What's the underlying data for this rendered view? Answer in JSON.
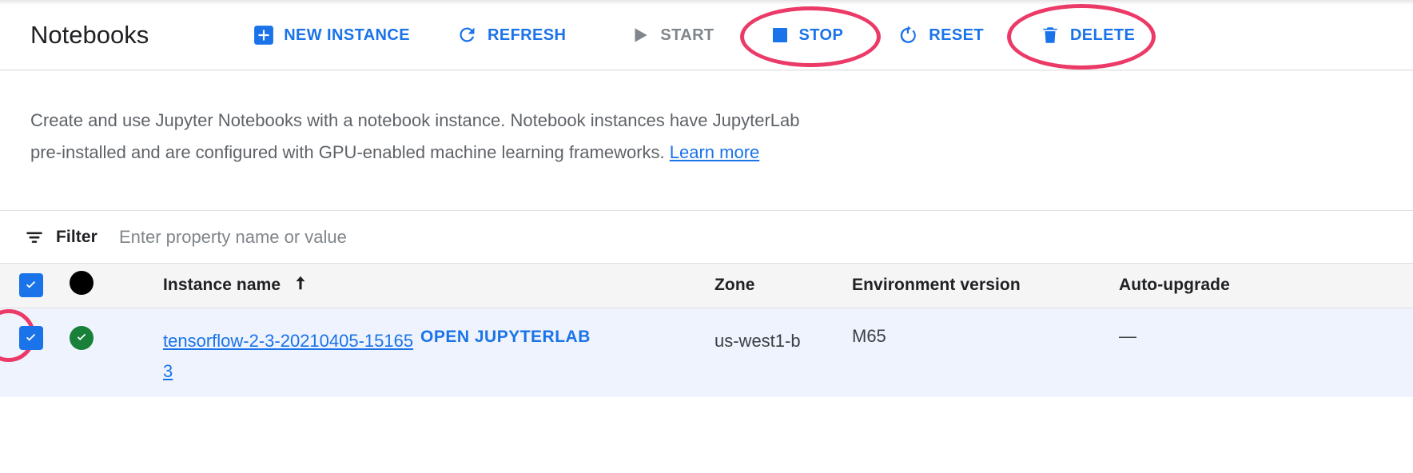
{
  "header": {
    "title": "Notebooks",
    "buttons": [
      {
        "label": "NEW INSTANCE",
        "icon": "plus-box-icon",
        "state": "enabled"
      },
      {
        "label": "REFRESH",
        "icon": "refresh-icon",
        "state": "enabled"
      },
      {
        "label": "START",
        "icon": "play-icon",
        "state": "disabled"
      },
      {
        "label": "STOP",
        "icon": "stop-square-icon",
        "state": "enabled",
        "annotated": true
      },
      {
        "label": "RESET",
        "icon": "power-reset-icon",
        "state": "enabled"
      },
      {
        "label": "DELETE",
        "icon": "trash-icon",
        "state": "enabled",
        "annotated": true
      }
    ]
  },
  "description": {
    "text_before": "Create and use Jupyter Notebooks with a notebook instance. Notebook instances have JupyterLab pre-installed and are configured with GPU-enabled machine learning frameworks. ",
    "link_label": "Learn more"
  },
  "filter": {
    "icon": "filter-icon",
    "label": "Filter",
    "placeholder": "Enter property name or value",
    "value": ""
  },
  "table": {
    "columns": [
      {
        "key": "checkbox",
        "label": ""
      },
      {
        "key": "status",
        "label": ""
      },
      {
        "key": "name",
        "label": "Instance name",
        "sort": "ascending",
        "sort_icon": "arrow-up-icon"
      },
      {
        "key": "open",
        "label": ""
      },
      {
        "key": "zone",
        "label": "Zone"
      },
      {
        "key": "env",
        "label": "Environment version"
      },
      {
        "key": "auto",
        "label": "Auto-upgrade"
      }
    ],
    "header_select_all_checked": true,
    "rows": [
      {
        "selected": true,
        "checkbox_annotated": true,
        "status": "healthy",
        "name": "tensorflow-2-3-20210405-151653",
        "open_label": "OPEN JUPYTERLAB",
        "zone": "us-west1-b",
        "environment_version": "M65",
        "auto_upgrade": "—"
      }
    ]
  },
  "colors": {
    "accent_blue": "#1a73e8",
    "annotation_pink": "#ec3a68",
    "status_green": "#188038",
    "disabled_gray": "#80868b",
    "selected_row_bg": "#eef3fd",
    "header_row_bg": "#f5f5f5"
  }
}
